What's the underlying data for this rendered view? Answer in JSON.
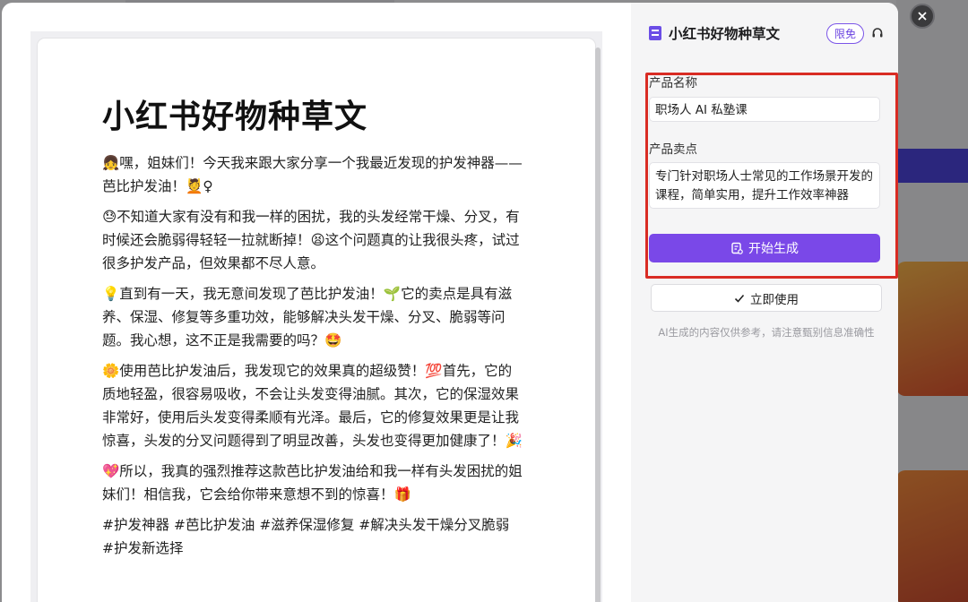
{
  "background": {
    "accent_band": "#4a43d8"
  },
  "document": {
    "title": "小红书好物种草文",
    "paragraphs": [
      "👧嘿，姐妹们！今天我来跟大家分享一个我最近发现的护发神器——芭比护发油！💆♀",
      "😓不知道大家有没有和我一样的困扰，我的头发经常干燥、分叉，有时候还会脆弱得轻轻一拉就断掉！😫这个问题真的让我很头疼，试过很多护发产品，但效果都不尽人意。",
      "💡直到有一天，我无意间发现了芭比护发油！🌱它的卖点是具有滋养、保湿、修复等多重功效，能够解决头发干燥、分叉、脆弱等问题。我心想，这不正是我需要的吗？🤩",
      "🌼使用芭比护发油后，我发现它的效果真的超级赞！💯首先，它的质地轻盈，很容易吸收，不会让头发变得油腻。其次，它的保湿效果非常好，使用后头发变得柔顺有光泽。最后，它的修复效果更是让我惊喜，头发的分叉问题得到了明显改善，头发也变得更加健康了！🎉",
      "💖所以，我真的强烈推荐这款芭比护发油给和我一样有头发困扰的姐妹们！相信我，它会给你带来意想不到的惊喜！🎁"
    ],
    "hashtags": "#护发神器 #芭比护发油 #滋养保湿修复 #解决头发干燥分叉脆弱 #护发新选择"
  },
  "panel": {
    "title": "小红书好物种草文",
    "badge": "限免",
    "icon_name": "headset-icon",
    "accent_color": "#7a48e8",
    "product_name_label": "产品名称",
    "product_name_value": "职场人 AI 私塾课",
    "selling_point_label": "产品卖点",
    "selling_point_value": "专门针对职场人士常见的工作场景开发的课程，简单实用，提升工作效率神器",
    "generate_button": "开始生成",
    "use_button": "立即使用",
    "disclaimer": "AI生成的内容仅供参考，请注意甄别信息准确性"
  }
}
